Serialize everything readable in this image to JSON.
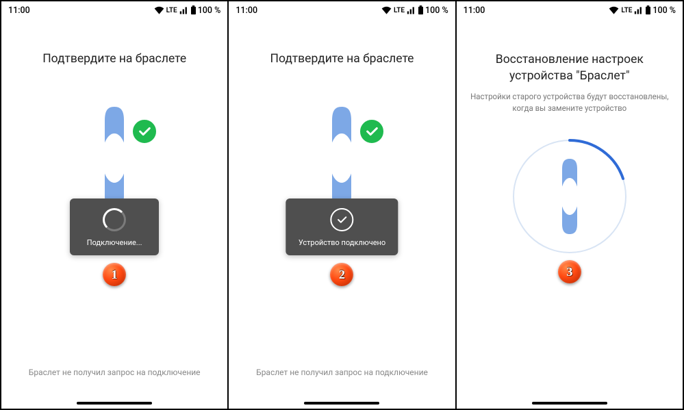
{
  "statusbar": {
    "time": "11:00",
    "lte": "LTE",
    "battery": "100 %"
  },
  "screens": [
    {
      "title": "Подтвердите на браслете",
      "toast": "Подключение...",
      "bottom": "Браслет не получил запрос на подключение",
      "marker": "1"
    },
    {
      "title": "Подтвердите на браслете",
      "toast": "Устройство подключено",
      "bottom": "Браслет не получил запрос на подключение",
      "marker": "2"
    },
    {
      "title": "Восстановление настроек устройства \"Браслет\"",
      "subtitle": "Настройки старого устройства будут восстановлены, когда вы замените устройство",
      "marker": "3"
    }
  ]
}
